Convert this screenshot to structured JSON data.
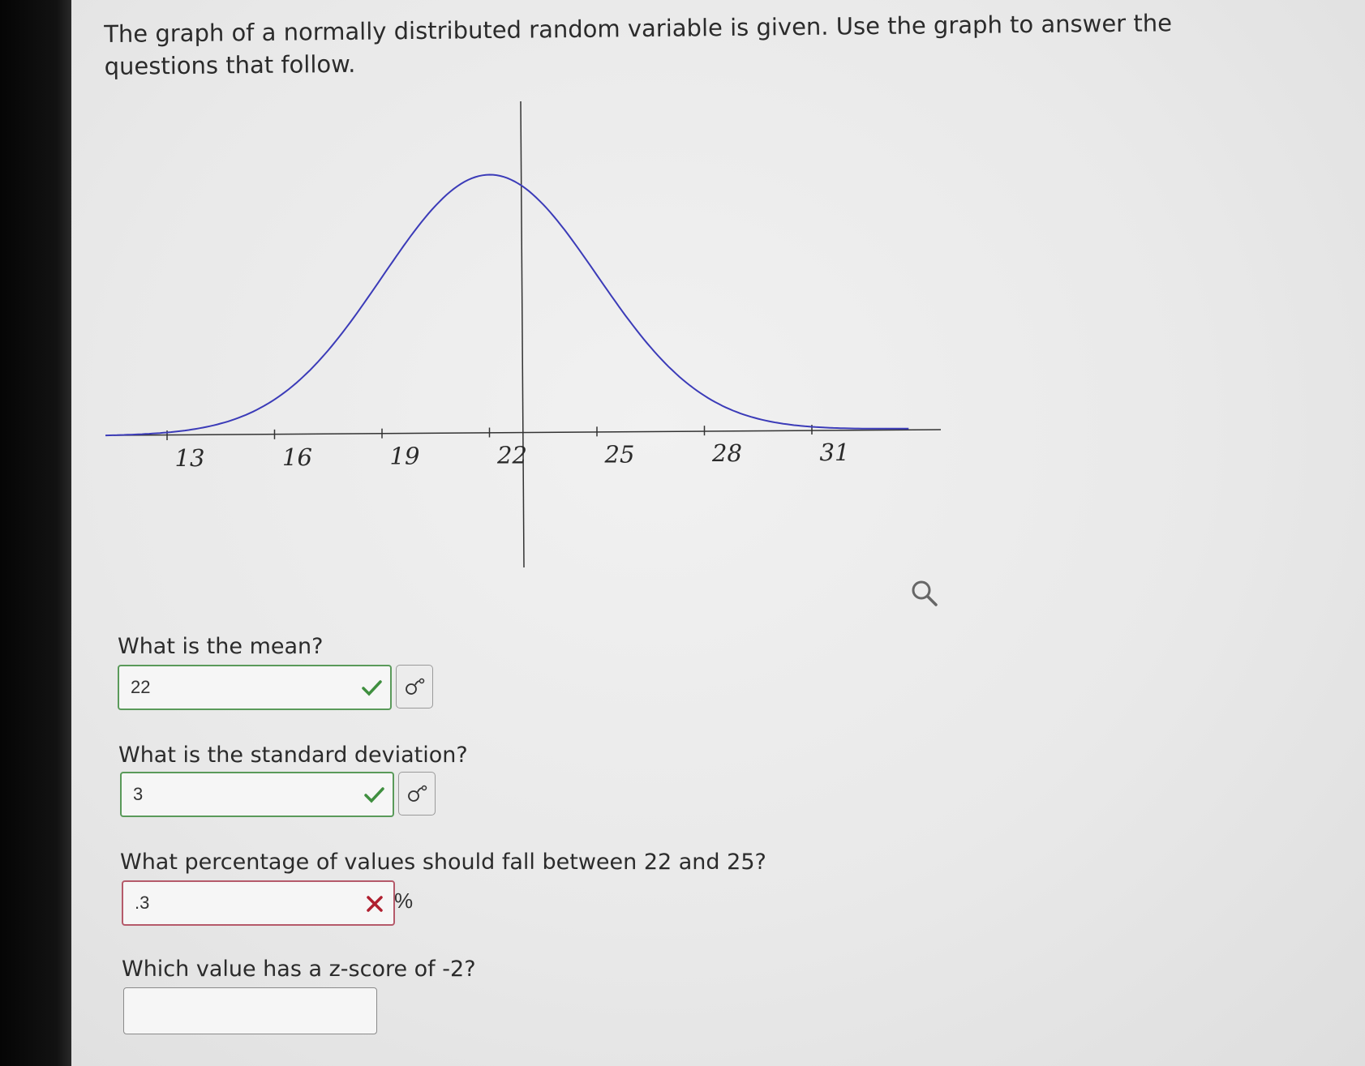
{
  "problem": {
    "intro": "The graph of a normally distributed random variable is given. Use the graph to answer the questions that follow."
  },
  "graph": {
    "x_ticks": [
      "13",
      "16",
      "19",
      "22",
      "25",
      "28",
      "31"
    ],
    "zoom_icon": "magnifier-icon",
    "curve_color": "#3b3bb8",
    "axis_color": "#333333"
  },
  "questions": [
    {
      "prompt": "What is the mean?",
      "answer": "22",
      "status": "correct",
      "help_icon": "formula-icon"
    },
    {
      "prompt": "What is the standard deviation?",
      "answer": "3",
      "status": "correct",
      "help_icon": "formula-icon"
    },
    {
      "prompt": "What percentage of values should fall between 22 and 25?",
      "answer": ".3",
      "status": "incorrect",
      "unit": "%"
    },
    {
      "prompt": "Which value has a z-score of -2?",
      "answer": "",
      "status": "unanswered"
    }
  ],
  "colors": {
    "correct": "#3f8f3f",
    "incorrect": "#b02030"
  }
}
